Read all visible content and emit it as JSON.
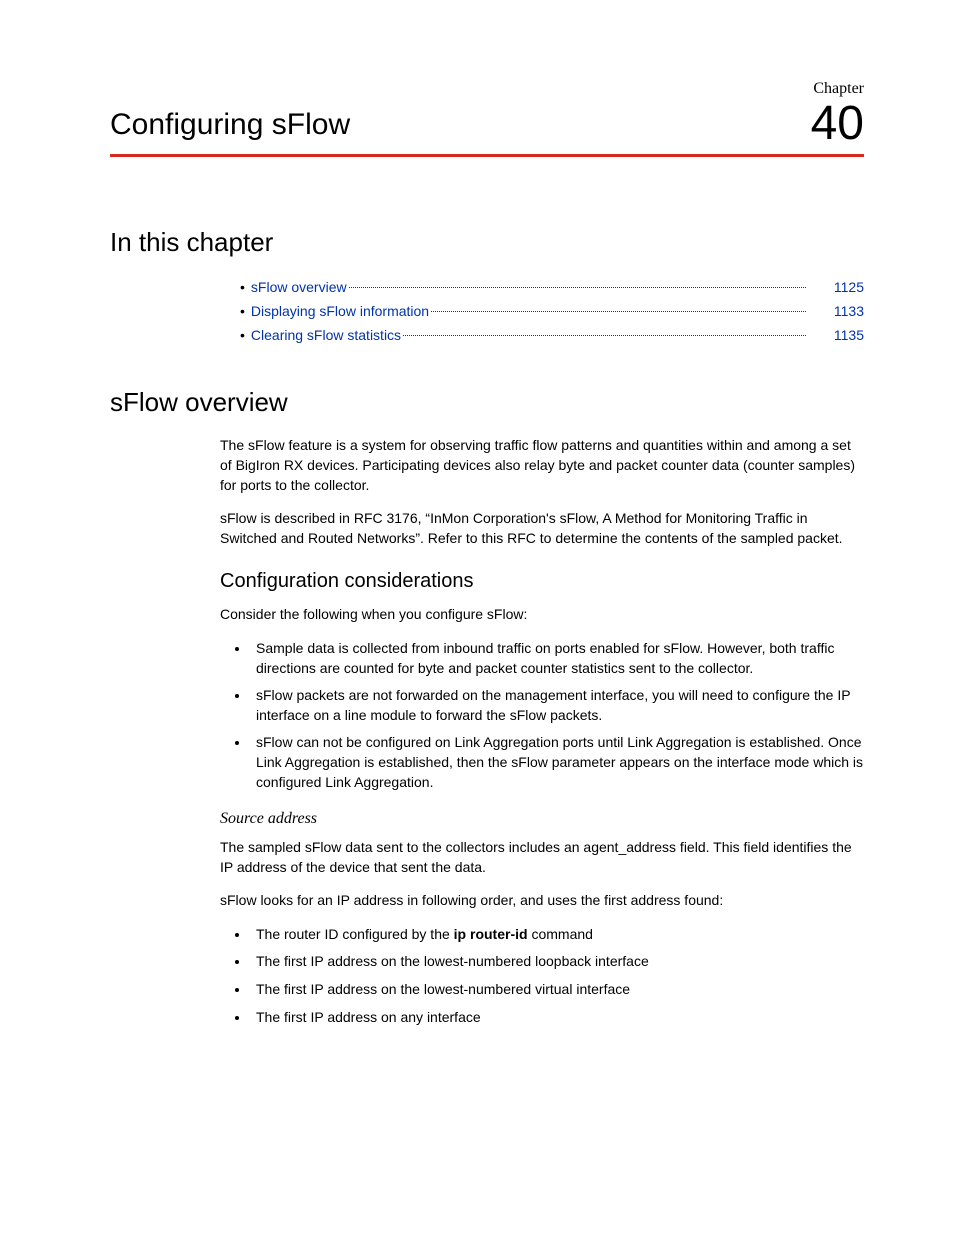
{
  "header": {
    "chapter_label": "Chapter",
    "chapter_number": "40",
    "chapter_title": "Configuring sFlow"
  },
  "sections": {
    "in_this_chapter": "In this chapter",
    "sflow_overview": "sFlow overview",
    "config_considerations": "Configuration considerations",
    "source_address": "Source address"
  },
  "toc": [
    {
      "label": "sFlow overview",
      "page": "1125"
    },
    {
      "label": "Displaying sFlow information",
      "page": "1133"
    },
    {
      "label": "Clearing sFlow statistics",
      "page": "1135"
    }
  ],
  "overview": {
    "p1": "The sFlow feature is a system for observing traffic flow patterns and quantities within and among a set of BigIron RX devices. Participating devices also relay byte and packet counter data (counter samples) for ports to the collector.",
    "p2": "sFlow is described in RFC 3176, “InMon Corporation's sFlow, A Method for Monitoring Traffic in Switched and Routed Networks”. Refer to this RFC to determine the contents of the sampled packet."
  },
  "config": {
    "intro": "Consider the following when you configure sFlow:",
    "bullets": [
      "Sample data is collected from inbound traffic on ports enabled for sFlow. However, both traffic directions are counted for byte and packet counter statistics sent to the collector.",
      "sFlow packets are not forwarded on the management interface, you will need to configure the IP interface on a line module to forward the sFlow packets.",
      "sFlow can not be configured on Link Aggregation ports until Link Aggregation is established. Once Link Aggregation is established, then the sFlow parameter appears on the interface mode which is configured Link Aggregation."
    ]
  },
  "source_addr": {
    "p1": "The sampled sFlow data sent to the collectors includes an agent_address field. This field identifies the IP address of the device that sent the data.",
    "p2": "sFlow looks for an IP address in following order, and uses the first address found:",
    "b1_pre": "The router ID configured by the ",
    "b1_cmd": "ip router-id",
    "b1_post": " command",
    "bullets_rest": [
      "The first IP address on the lowest-numbered loopback interface",
      "The first IP address on the lowest-numbered virtual interface",
      "The first IP address on any interface"
    ]
  }
}
